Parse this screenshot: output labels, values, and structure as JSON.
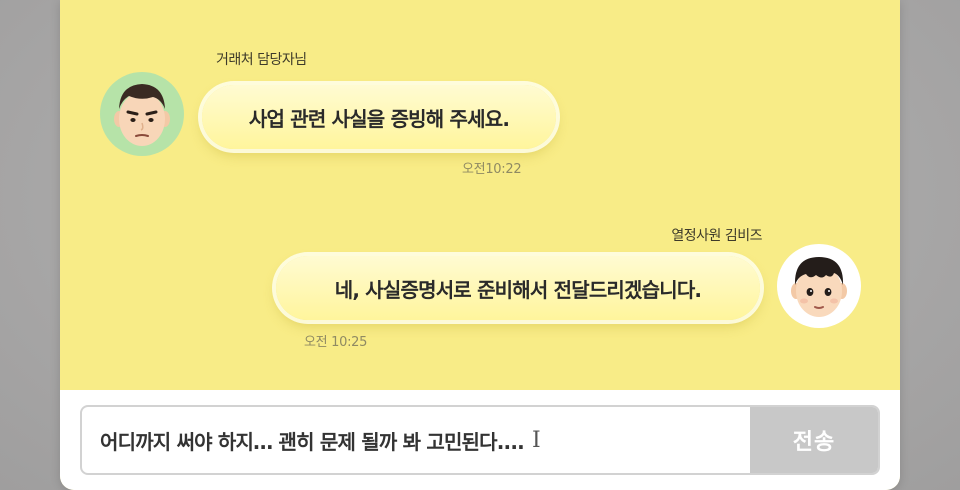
{
  "messages": [
    {
      "sender": "거래처 담당자님",
      "text": "사업 관련 사실을 증빙해 주세요.",
      "time": "오전10:22",
      "avatar": "male-client-avatar"
    },
    {
      "sender": "열정사원 김비즈",
      "text": "네, 사실증명서로 준비해서 전달드리겠습니다.",
      "time": "오전 10:25",
      "avatar": "employee-avatar"
    }
  ],
  "composer": {
    "input_value": "어디까지 써야 하지… 괜히 문제 될까 봐 고민된다....",
    "send_label": "전송"
  },
  "colors": {
    "chat_background": "#f8ec87",
    "bubble": "#fff59c",
    "left_avatar_bg": "#b6e3a8",
    "send_button": "#c8c8c8"
  }
}
